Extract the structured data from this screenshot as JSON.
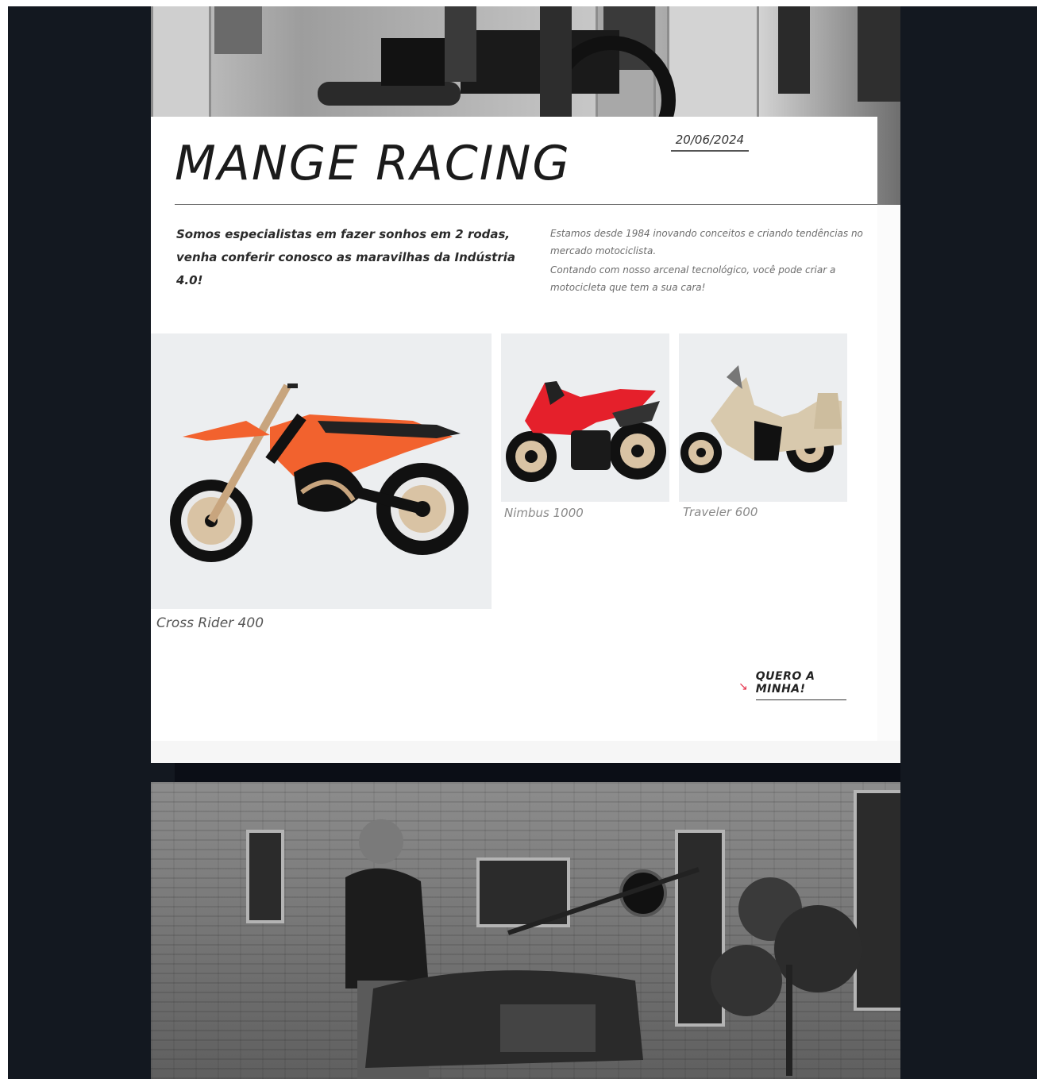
{
  "header": {
    "title": "MANGE RACING",
    "date": "20/06/2024"
  },
  "intro": {
    "slogan_line1": "Somos especialistas em fazer sonhos em 2 rodas,",
    "slogan_line2": "venha conferir conosco as maravilhas da Indústria 4.0!",
    "about_p1": "Estamos desde 1984 inovando conceitos e criando tendências no mercado motociclista.",
    "about_p2": "Contando com nosso arcenal tecnológico, você pode criar a motocicleta que tem a sua cara!"
  },
  "products": [
    {
      "name": "Cross Rider 400",
      "color": "#f2622e"
    },
    {
      "name": "Nimbus 1000",
      "color": "#e5202b"
    },
    {
      "name": "Traveler 600",
      "color": "#d8c9ad"
    }
  ],
  "cta": {
    "label": "QUERO A MINHA!",
    "arrow_icon": "arrow-down-right-icon",
    "accent": "#e5304a"
  }
}
